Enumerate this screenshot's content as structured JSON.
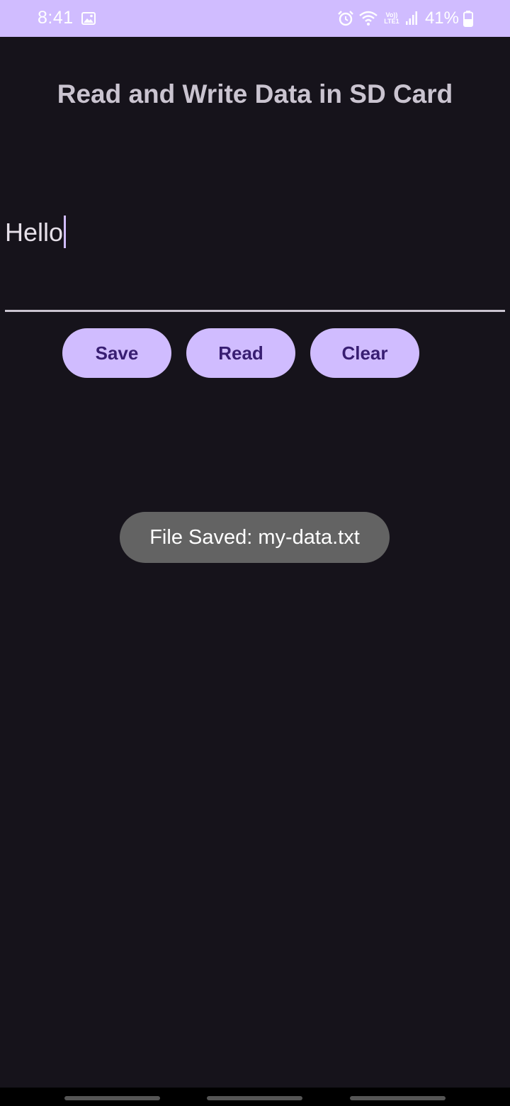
{
  "status_bar": {
    "time": "8:41",
    "volte_line1": "Vo))",
    "volte_line2": "LTE1",
    "battery_percent": "41%",
    "icons": [
      "gallery-icon",
      "alarm-icon",
      "wifi-icon",
      "volte-icon",
      "signal-icon",
      "battery-icon"
    ],
    "background_color": "#d0bcff"
  },
  "header": {
    "title": "Read and Write Data in SD Card"
  },
  "editor": {
    "value": "Hello"
  },
  "actions": {
    "save_label": "Save",
    "read_label": "Read",
    "clear_label": "Clear",
    "button_color": "#d0bcff",
    "button_text_color": "#381e72"
  },
  "toast": {
    "message": "File Saved: my-data.txt"
  },
  "theme": {
    "background": "#16131b",
    "title_color": "#cac4d0"
  }
}
